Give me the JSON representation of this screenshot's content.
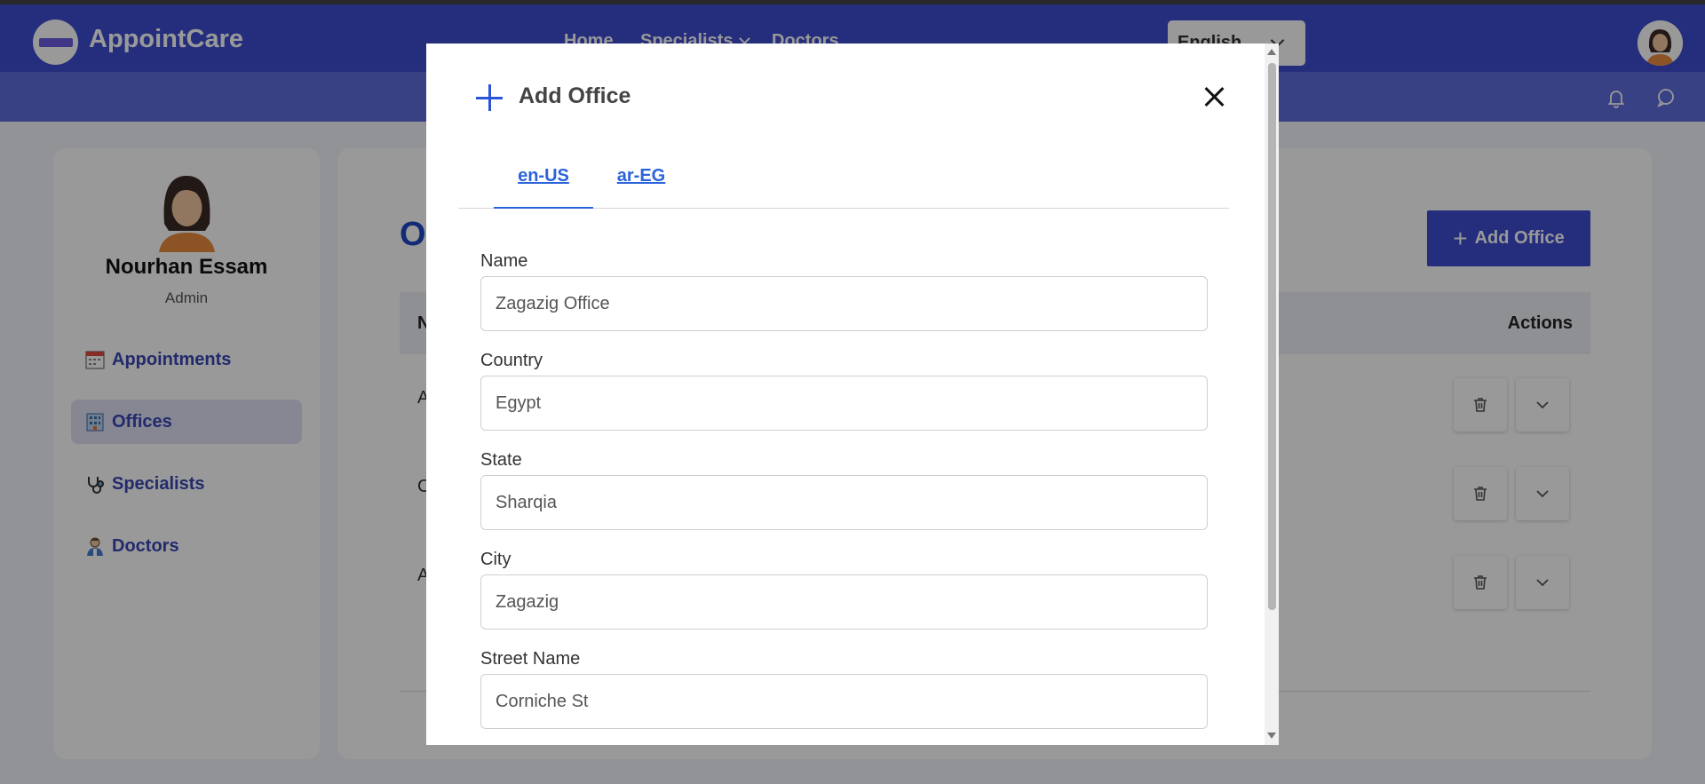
{
  "app": {
    "brand": "AppointCare"
  },
  "nav": {
    "links": [
      {
        "label": "Home"
      },
      {
        "label": "Specialists"
      },
      {
        "label": "Doctors"
      }
    ],
    "language": "English"
  },
  "profile": {
    "name": "Nourhan Essam",
    "role": "Admin"
  },
  "sidebar": {
    "items": [
      {
        "label": "Appointments",
        "icon": "calendar-icon",
        "active": false
      },
      {
        "label": "Offices",
        "icon": "building-icon",
        "active": true
      },
      {
        "label": "Specialists",
        "icon": "stethoscope-icon",
        "active": false
      },
      {
        "label": "Doctors",
        "icon": "doctor-icon",
        "active": false
      }
    ]
  },
  "main": {
    "title_fragment": "O",
    "add_button": "Add Office",
    "table": {
      "header_first": "N",
      "header_actions": "Actions",
      "row_fragments": [
        "A",
        "C",
        "A"
      ]
    }
  },
  "modal": {
    "title": "Add Office",
    "tabs": [
      {
        "label": "en-US",
        "active": true
      },
      {
        "label": "ar-EG",
        "active": false
      }
    ],
    "fields": [
      {
        "label": "Name",
        "value": "Zagazig Office"
      },
      {
        "label": "Country",
        "value": "Egypt"
      },
      {
        "label": "State",
        "value": "Sharqia"
      },
      {
        "label": "City",
        "value": "Zagazig"
      },
      {
        "label": "Street Name",
        "value": "Corniche St"
      }
    ]
  },
  "colors": {
    "navbar": "#3f4bd0",
    "subbar": "#5f6dde",
    "accent": "#2b63d9",
    "sidebar_text": "#3a47b4"
  }
}
